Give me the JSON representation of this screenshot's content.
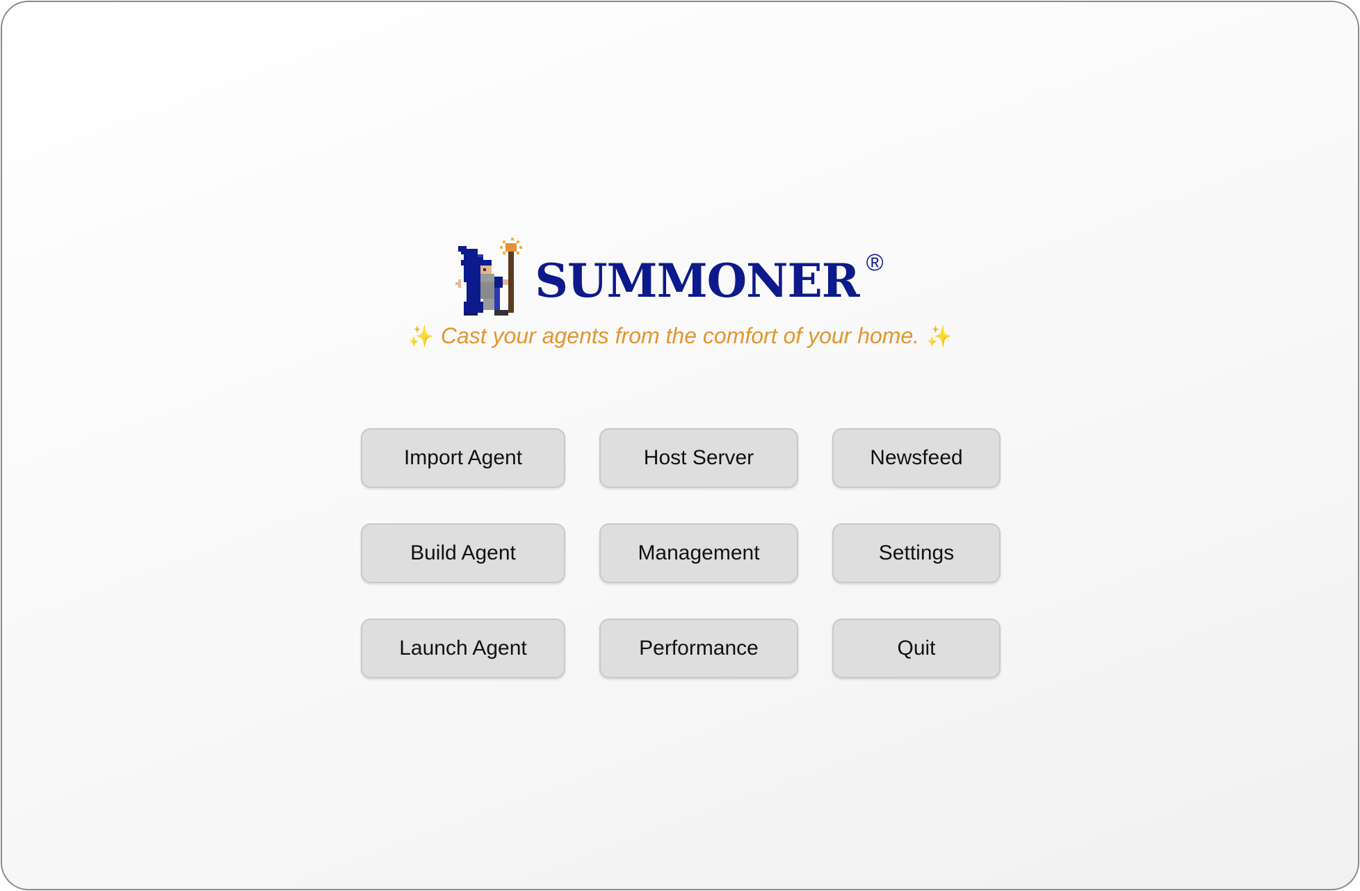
{
  "app": {
    "title": "SUMMONER",
    "registered_mark": "®",
    "tagline": "Cast your agents from the comfort of your home.",
    "tagline_sparkle": "✨",
    "logo_icon": "pixel-wizard-icon"
  },
  "colors": {
    "brand": "#0d1a8c",
    "tagline": "#e0962f",
    "button_bg": "#dedede",
    "button_border": "#c9c9c9"
  },
  "menu": {
    "import_agent": "Import Agent",
    "host_server": "Host Server",
    "newsfeed": "Newsfeed",
    "build_agent": "Build Agent",
    "management": "Management",
    "settings": "Settings",
    "launch_agent": "Launch Agent",
    "performance": "Performance",
    "quit": "Quit"
  }
}
